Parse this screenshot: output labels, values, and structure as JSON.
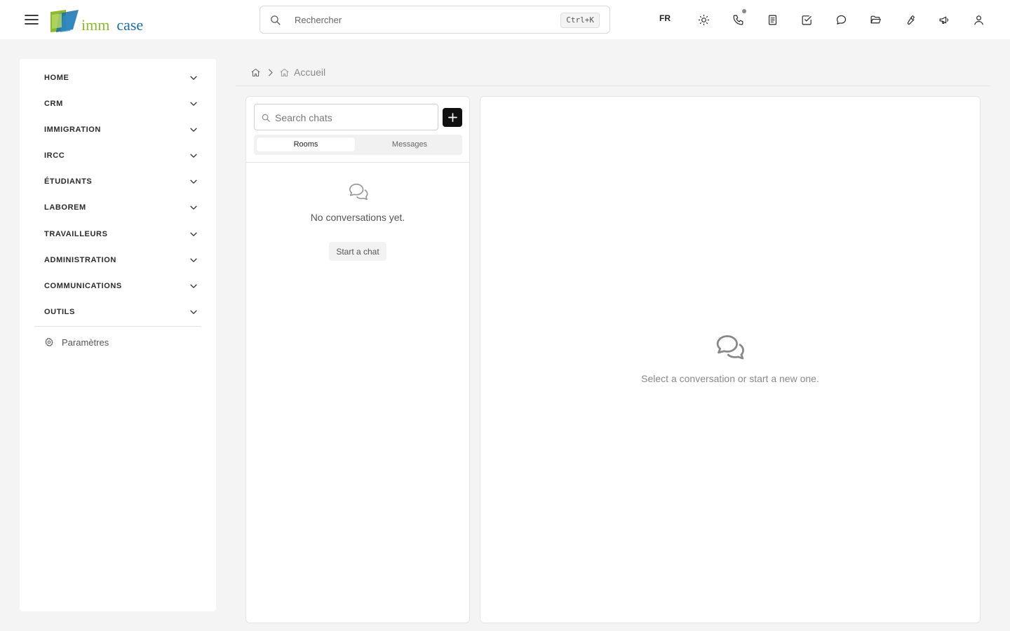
{
  "brand": {
    "part1": "imm",
    "part2": "case",
    "color_green": "#8cba2a",
    "color_blue": "#1a6ea8"
  },
  "topbar": {
    "search_placeholder": "Rechercher",
    "shortcut": "Ctrl+K",
    "language": "FR",
    "icons": [
      "sun-icon",
      "phone-icon",
      "notes-icon",
      "tasks-icon",
      "chat-icon",
      "folder-open-icon",
      "wrench-icon",
      "megaphone-icon",
      "user-icon"
    ]
  },
  "sidebar": {
    "items": [
      {
        "label": "HOME"
      },
      {
        "label": "CRM"
      },
      {
        "label": "IMMIGRATION"
      },
      {
        "label": "IRCC"
      },
      {
        "label": "ÉTUDIANTS"
      },
      {
        "label": "LABOREM"
      },
      {
        "label": "TRAVAILLEURS"
      },
      {
        "label": "ADMINISTRATION"
      },
      {
        "label": "COMMUNICATIONS"
      },
      {
        "label": "OUTILS"
      }
    ],
    "settings_label": "Paramètres"
  },
  "breadcrumb": {
    "current": "Accueil"
  },
  "chat_list": {
    "search_placeholder": "Search chats",
    "tabs": [
      {
        "label": "Rooms",
        "active": true
      },
      {
        "label": "Messages",
        "active": false
      }
    ],
    "empty_text": "No conversations yet.",
    "start_label": "Start a chat"
  },
  "conversation": {
    "empty_text": "Select a conversation or start a new one."
  }
}
